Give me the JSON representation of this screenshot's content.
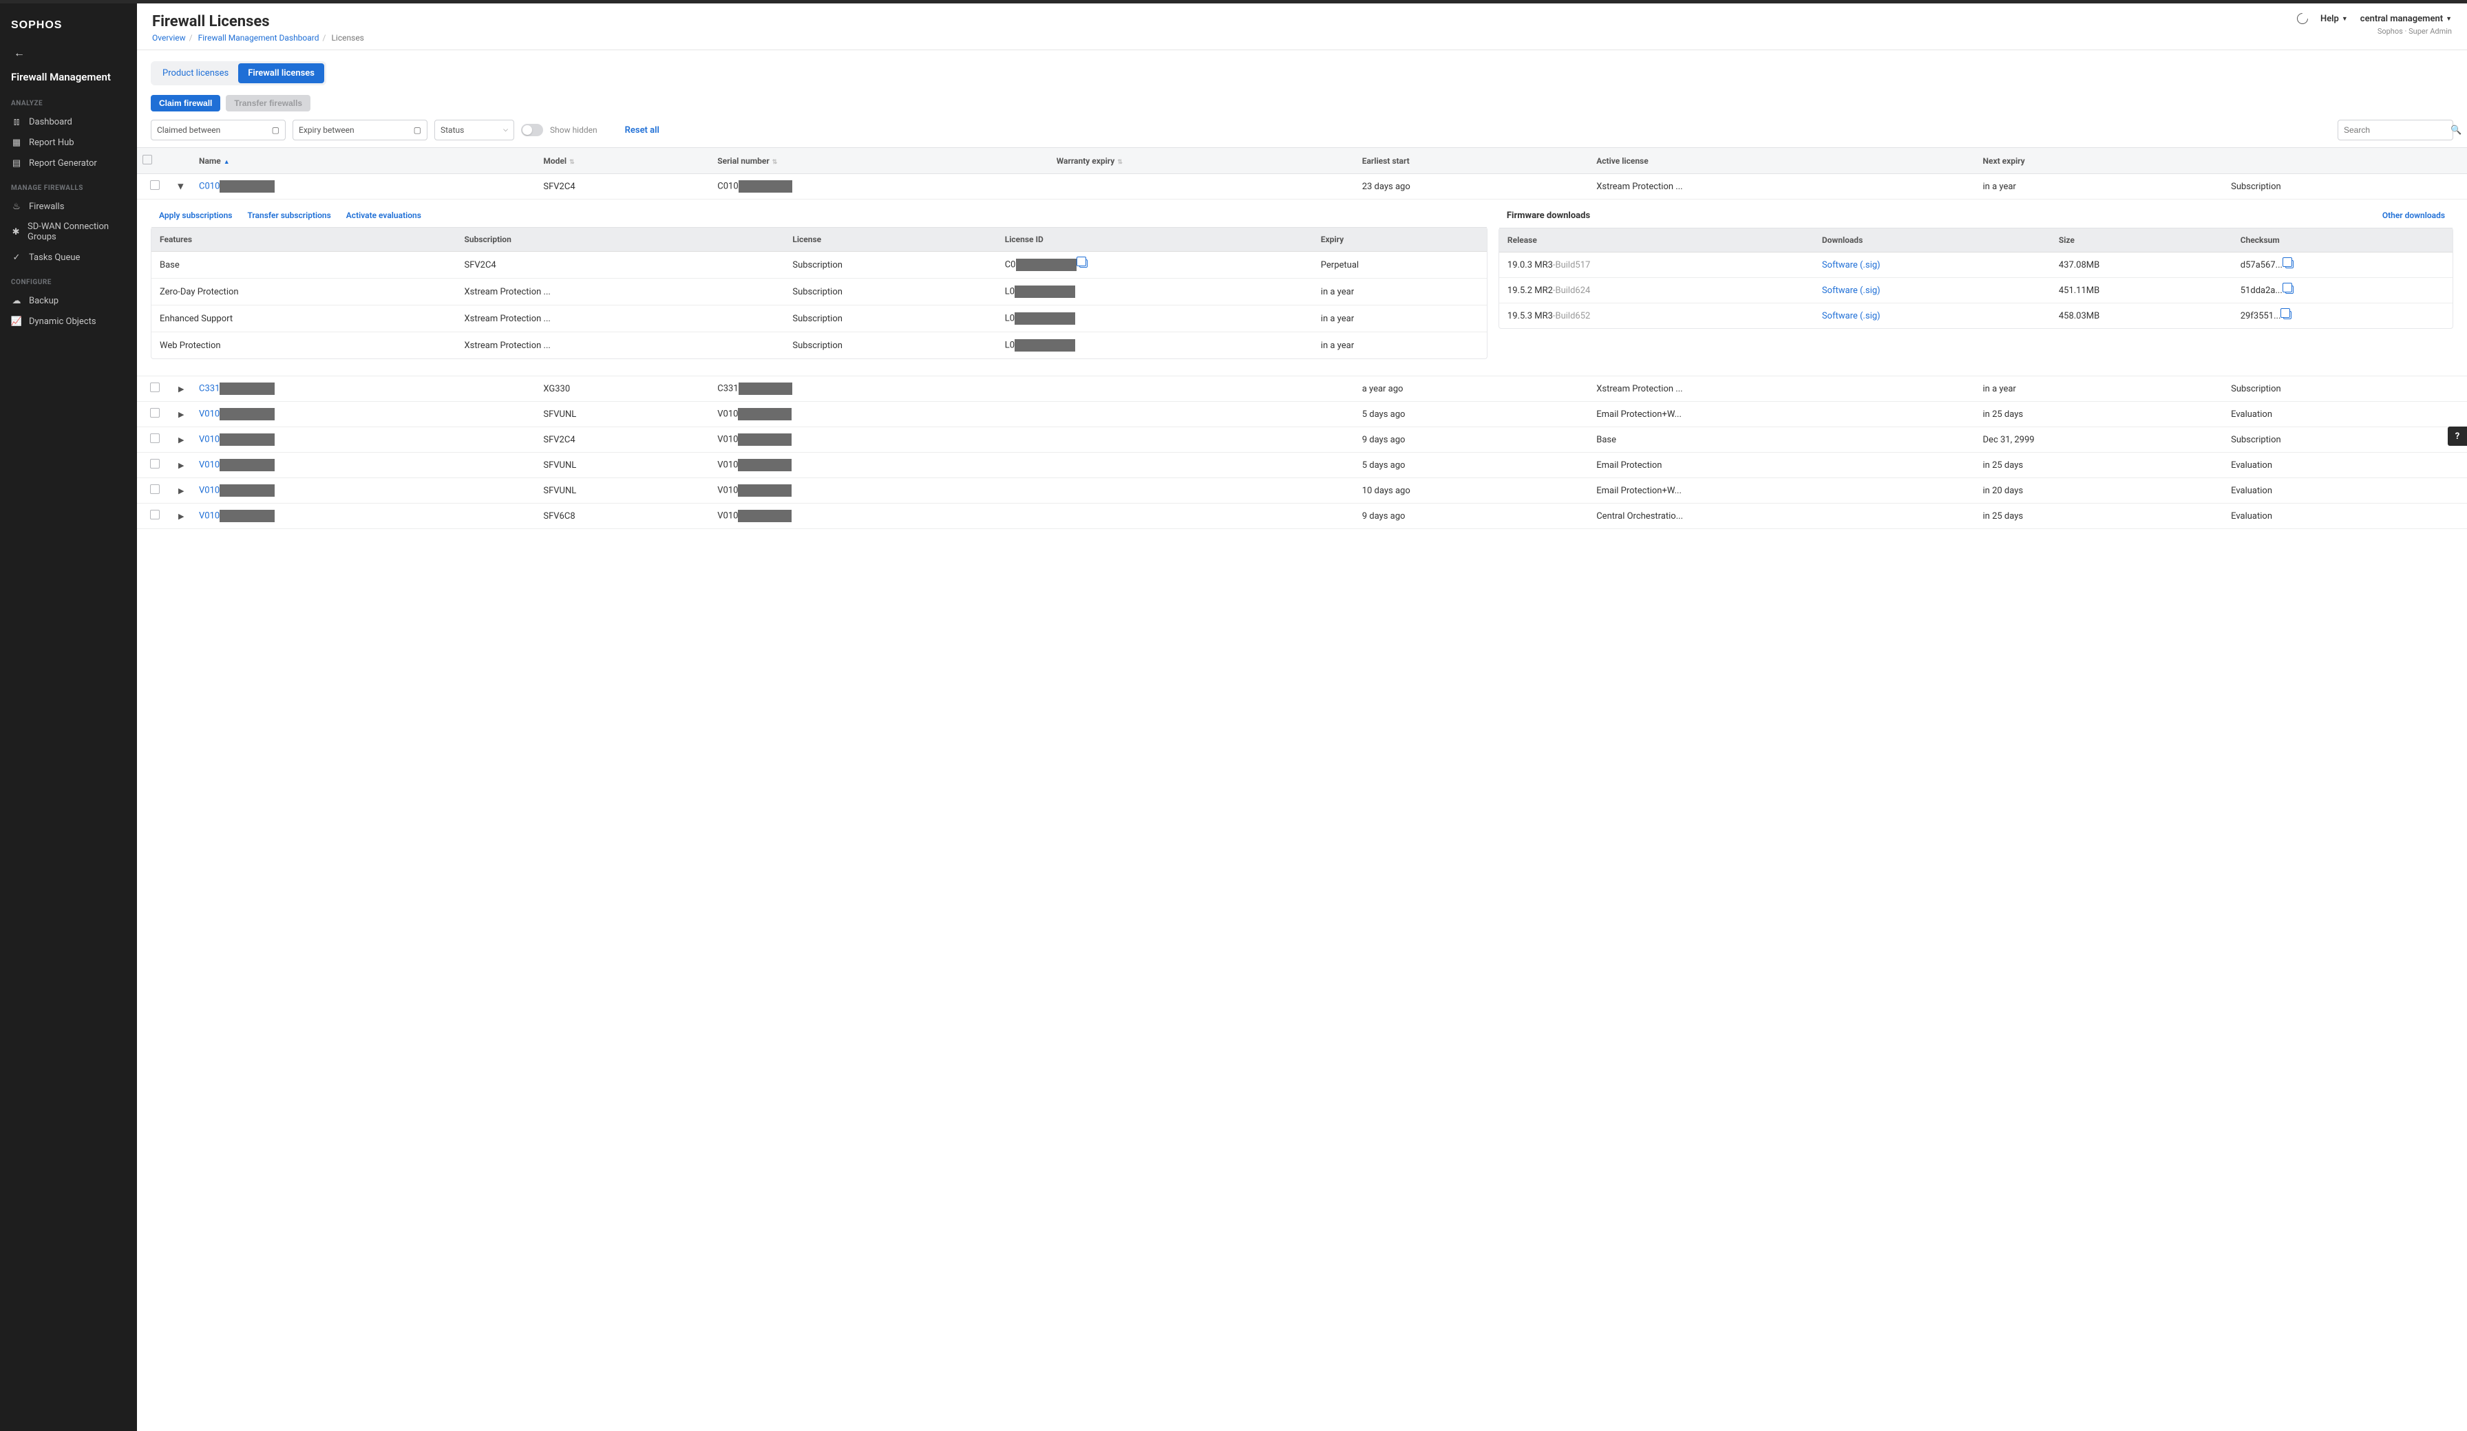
{
  "brand": "SOPHOS",
  "side_title": "Firewall Management",
  "side_groups": {
    "analyze": "ANALYZE",
    "manage": "MANAGE FIREWALLS",
    "configure": "CONFIGURE"
  },
  "nav": {
    "dashboard": "Dashboard",
    "report_hub": "Report Hub",
    "report_gen": "Report Generator",
    "firewalls": "Firewalls",
    "sdwan": "SD-WAN Connection Groups",
    "tasks": "Tasks Queue",
    "backup": "Backup",
    "dynamic": "Dynamic Objects"
  },
  "header": {
    "title": "Firewall Licenses",
    "crumb_overview": "Overview",
    "crumb_dash": "Firewall Management Dashboard",
    "crumb_current": "Licenses",
    "help": "Help",
    "account": "central management",
    "sub": "Sophos · Super Admin"
  },
  "tabs": {
    "product": "Product licenses",
    "firewall": "Firewall licenses"
  },
  "buttons": {
    "claim": "Claim firewall",
    "transfer": "Transfer firewalls"
  },
  "filters": {
    "claimed": "Claimed between",
    "expiry": "Expiry between",
    "status": "Status",
    "show_hidden": "Show hidden",
    "reset": "Reset all",
    "search_ph": "Search"
  },
  "cols": {
    "name": "Name",
    "model": "Model",
    "serial": "Serial number",
    "warranty": "Warranty expiry",
    "earliest": "Earliest start",
    "active": "Active license",
    "next": "Next expiry",
    "last": ""
  },
  "rows": [
    {
      "name": "C010",
      "model": "SFV2C4",
      "serial": "C010",
      "warranty": "",
      "earliest": "23 days ago",
      "active": "Xstream Protection ...",
      "next": "in a year",
      "last": "Subscription",
      "expanded": true
    },
    {
      "name": "C331",
      "model": "XG330",
      "serial": "C331",
      "warranty": "",
      "earliest": "a year ago",
      "active": "Xstream Protection ...",
      "next": "in a year",
      "last": "Subscription"
    },
    {
      "name": "V010",
      "model": "SFVUNL",
      "serial": "V010",
      "warranty": "",
      "earliest": "5 days ago",
      "active": "Email Protection+W...",
      "next": "in 25 days",
      "last": "Evaluation",
      "eval": true
    },
    {
      "name": "V010",
      "model": "SFV2C4",
      "serial": "V010",
      "warranty": "",
      "earliest": "9 days ago",
      "active": "Base",
      "next": "Dec 31, 2999",
      "last": "Subscription"
    },
    {
      "name": "V010",
      "model": "SFVUNL",
      "serial": "V010",
      "warranty": "",
      "earliest": "5 days ago",
      "active": "Email Protection",
      "next": "in 25 days",
      "last": "Evaluation",
      "eval": true
    },
    {
      "name": "V010",
      "model": "SFVUNL",
      "serial": "V010",
      "warranty": "",
      "earliest": "10 days ago",
      "active": "Email Protection+W...",
      "next": "in 20 days",
      "last": "Evaluation",
      "eval": true
    },
    {
      "name": "V010",
      "model": "SFV6C8",
      "serial": "V010",
      "warranty": "",
      "earliest": "9 days ago",
      "active": "Central Orchestratio...",
      "next": "in 25 days",
      "last": "Evaluation",
      "eval": true
    }
  ],
  "exp": {
    "actions": {
      "apply": "Apply subscriptions",
      "transfer": "Transfer subscriptions",
      "activate": "Activate evaluations"
    },
    "cols": {
      "features": "Features",
      "subscription": "Subscription",
      "license": "License",
      "license_id": "License ID",
      "expiry": "Expiry"
    },
    "rows": [
      {
        "features": "Base",
        "subscription": "SFV2C4",
        "license": "Subscription",
        "lid": "C0",
        "expiry": "Perpetual",
        "copy": true
      },
      {
        "features": "Zero-Day Protection",
        "subscription": "Xstream Protection ...",
        "license": "Subscription",
        "lid": "L0",
        "expiry": "in a year"
      },
      {
        "features": "Enhanced Support",
        "subscription": "Xstream Protection ...",
        "license": "Subscription",
        "lid": "L0",
        "expiry": "in a year"
      },
      {
        "features": "Web Protection",
        "subscription": "Xstream Protection ...",
        "license": "Subscription",
        "lid": "L0",
        "expiry": "in a year"
      }
    ],
    "fw_title": "Firmware downloads",
    "other": "Other downloads",
    "fw_cols": {
      "release": "Release",
      "downloads": "Downloads",
      "size": "Size",
      "checksum": "Checksum"
    },
    "fw_rows": [
      {
        "release": "19.0.3 MR3",
        "build": "-Build517",
        "link": "Software (.sig)",
        "size": "437.08MB",
        "checksum": "d57a567..."
      },
      {
        "release": "19.5.2 MR2",
        "build": "-Build624",
        "link": "Software (.sig)",
        "size": "451.11MB",
        "checksum": "51dda2a..."
      },
      {
        "release": "19.5.3 MR3",
        "build": "-Build652",
        "link": "Software (.sig)",
        "size": "458.03MB",
        "checksum": "29f3551..."
      }
    ]
  }
}
